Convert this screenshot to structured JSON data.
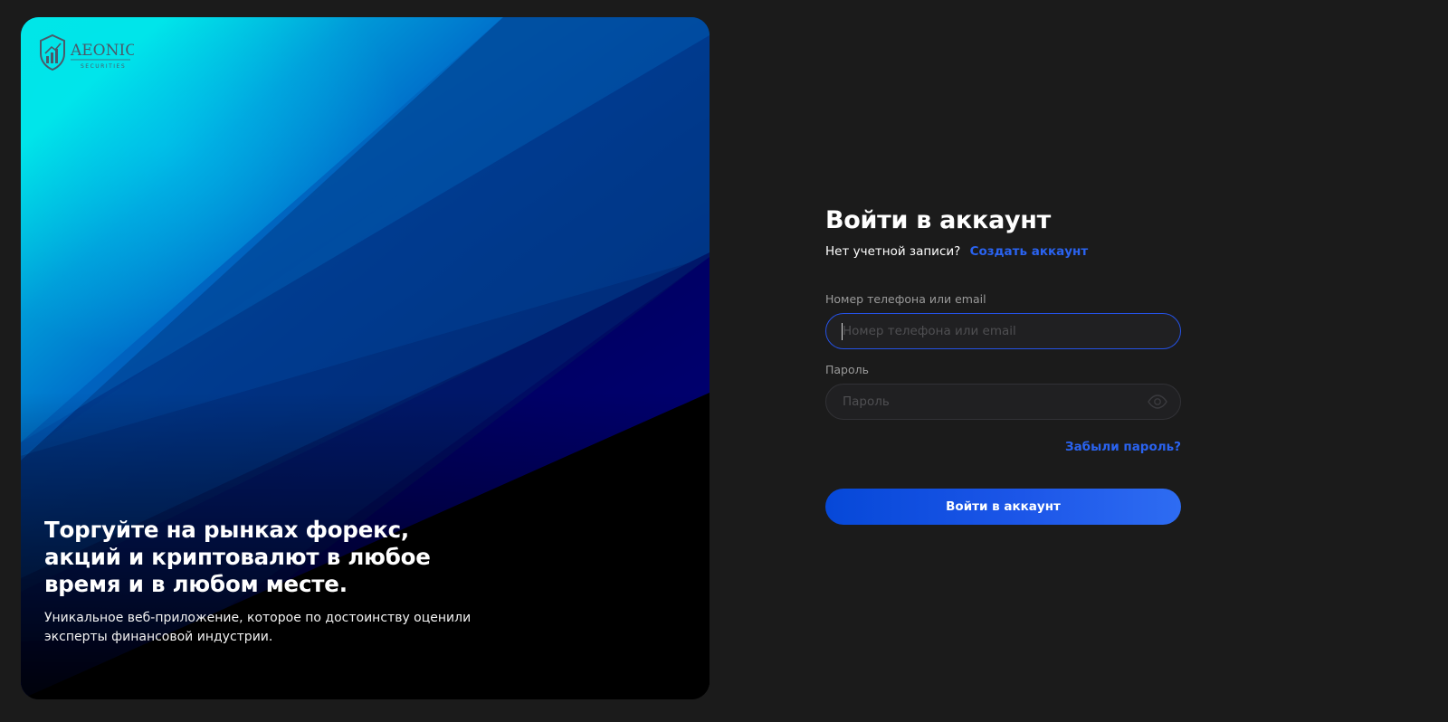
{
  "brand": {
    "logo_name": "AEONIC",
    "logo_tagline": "SECURITIES"
  },
  "hero": {
    "title_line1": "Торгуйте на рынках форекс,",
    "title_line2": "акций и криптовалют в любое",
    "title_line3": "время и в любом месте.",
    "subtitle_line1": "Уникальное веб-приложение, которое по достоинству оценили",
    "subtitle_line2": "эксперты финансовой индустрии."
  },
  "form": {
    "title": "Войти в аккаунт",
    "no_account_text": "Нет учетной записи?",
    "signup_link": "Создать аккаунт",
    "login_label": "Номер телефона или email",
    "login_placeholder": "Номер телефона или email",
    "login_value": "",
    "password_label": "Пароль",
    "password_placeholder": "Пароль",
    "password_value": "",
    "forgot_link": "Забыли пароль?",
    "submit_label": "Войти в аккаунт"
  },
  "icons": {
    "logo": "shield-chart-icon",
    "password_toggle": "eye-icon"
  },
  "colors": {
    "background": "#1b1b1b",
    "accent": "#2a63f0",
    "button": "#0648d8",
    "hero_cyan": "#00ffe1",
    "hero_navy": "#000080"
  }
}
